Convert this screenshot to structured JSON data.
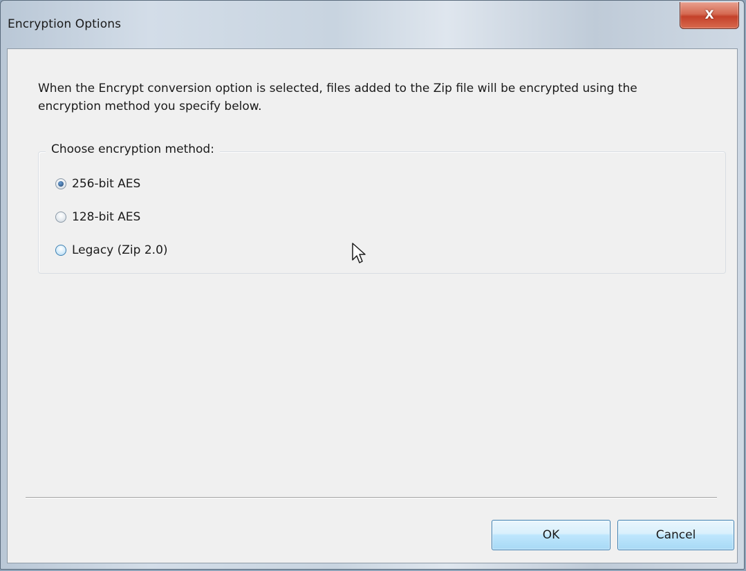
{
  "window": {
    "title": "Encryption Options",
    "close_label": "X"
  },
  "description": "When the Encrypt conversion option is selected, files added to the Zip file will be encrypted using the encryption method you specify below.",
  "encryption_group": {
    "legend": "Choose encryption method:",
    "options": [
      {
        "label": "256-bit AES",
        "selected": true
      },
      {
        "label": "128-bit AES",
        "selected": false
      },
      {
        "label": "Legacy (Zip 2.0)",
        "selected": false
      }
    ]
  },
  "buttons": {
    "ok_label": "OK",
    "cancel_label": "Cancel"
  },
  "icons": {
    "close": "close-icon",
    "cursor": "mouse-cursor-icon"
  },
  "colors": {
    "button_border": "#3c7fb1",
    "close_button": "#c4412a",
    "dialog_background": "#f0f0f0"
  }
}
